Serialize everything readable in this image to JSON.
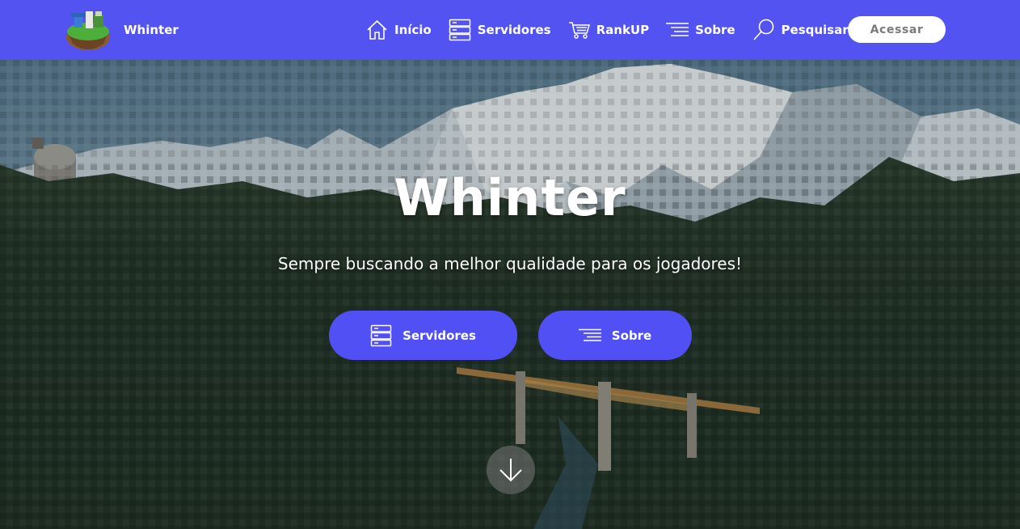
{
  "brand": {
    "name": "Whinter",
    "logo_icon": "island-logo-icon"
  },
  "nav": {
    "items": [
      {
        "label": "Início",
        "icon": "home-icon"
      },
      {
        "label": "Servidores",
        "icon": "server-icon"
      },
      {
        "label": "RankUP",
        "icon": "cart-icon"
      },
      {
        "label": "Sobre",
        "icon": "lines-icon"
      },
      {
        "label": "Pesquisar",
        "icon": "search-icon"
      }
    ],
    "access_label": "Acessar"
  },
  "hero": {
    "title": "Whinter",
    "subtitle": "Sempre buscando a melhor qualidade para os jogadores!",
    "buttons": [
      {
        "label": "Servidores",
        "icon": "server-icon"
      },
      {
        "label": "Sobre",
        "icon": "lines-icon"
      }
    ],
    "scroll_icon": "arrow-down-icon"
  },
  "colors": {
    "nav_bg": "#5353f2",
    "button_bg": "#5050f4",
    "access_text": "#7a7a7a"
  }
}
